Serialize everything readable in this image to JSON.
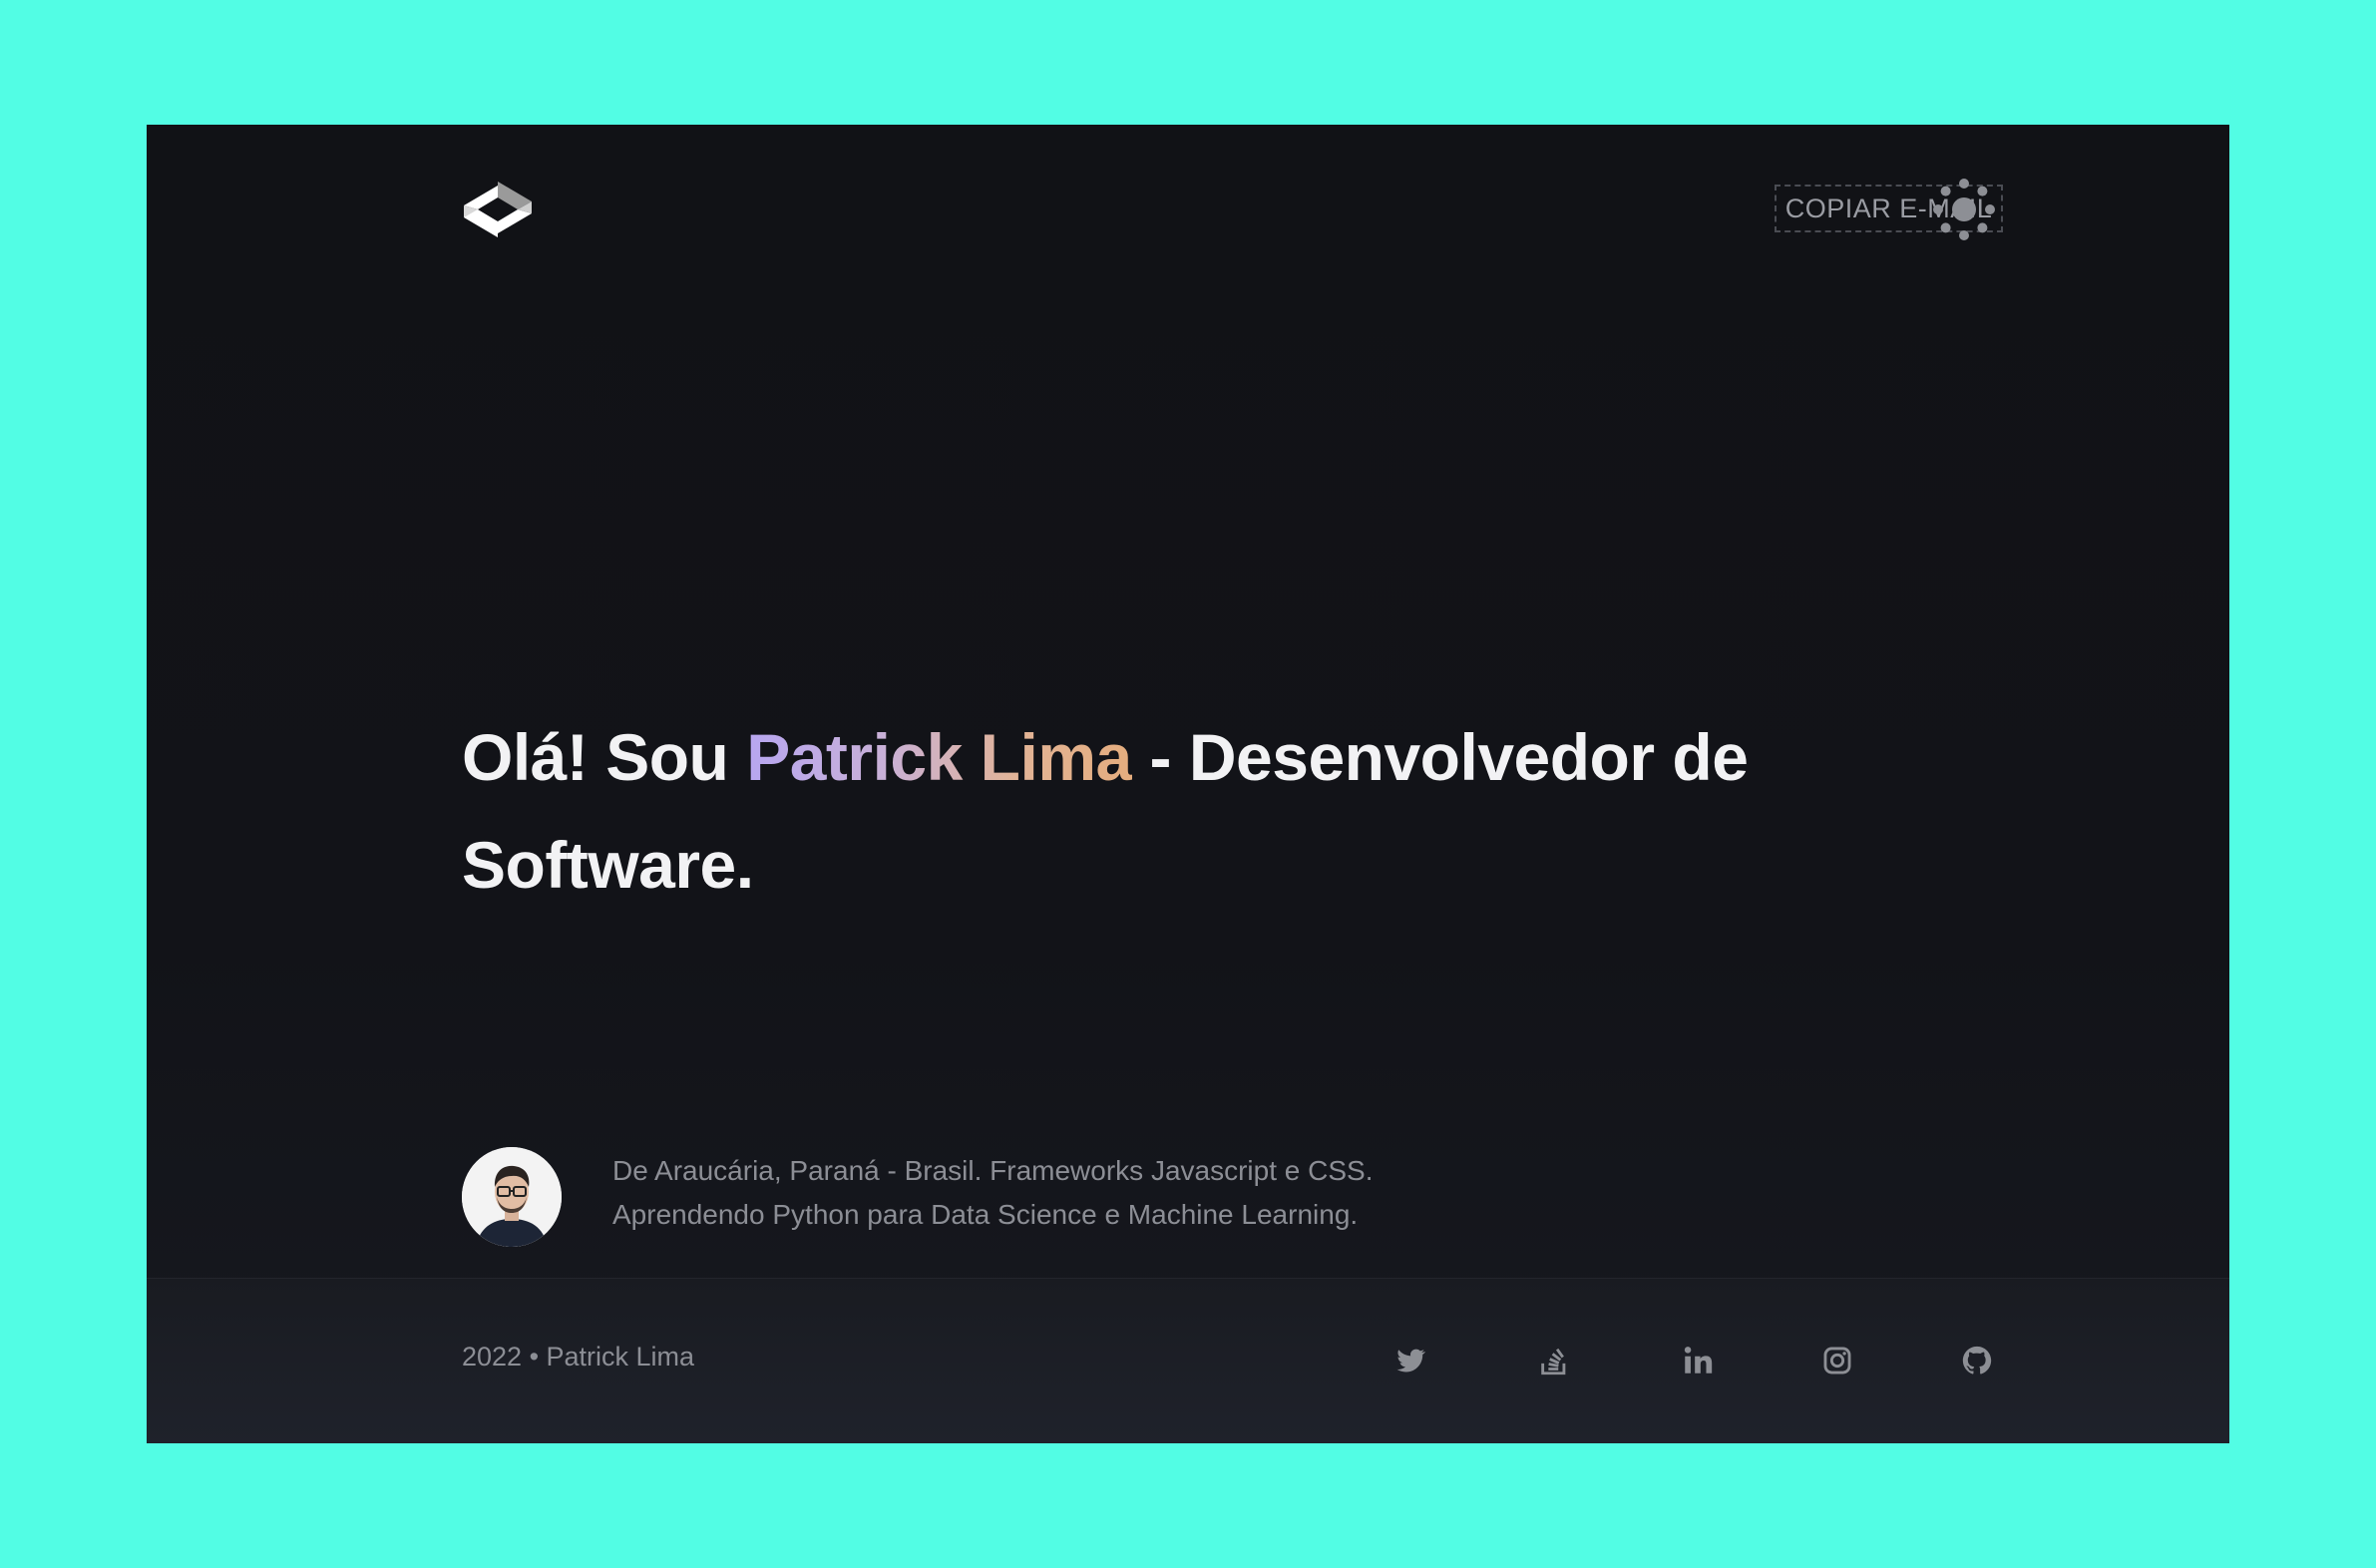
{
  "header": {
    "logo_icon": "code-brackets-logo-icon",
    "copy_email_label": "COPIAR E-MAIL",
    "theme_toggle_icon": "sun-icon"
  },
  "hero": {
    "greeting": "Olá! Sou ",
    "name": "Patrick Lima",
    "role": " - Desenvolvedor de Software.",
    "name_gradient_colors": [
      "#b7a6f0",
      "#e4ad7e"
    ]
  },
  "bio": {
    "line1": "De Araucária, Paraná - Brasil. Frameworks Javascript e CSS.",
    "line2": "Aprendendo Python para Data Science e Machine Learning."
  },
  "footer": {
    "copyright": "2022 • Patrick Lima",
    "social": [
      {
        "icon": "twitter-icon"
      },
      {
        "icon": "stackoverflow-icon"
      },
      {
        "icon": "linkedin-icon"
      },
      {
        "icon": "instagram-icon"
      },
      {
        "icon": "github-icon"
      }
    ]
  },
  "colors": {
    "page_background": "#52fde4",
    "window_background": "#111216",
    "footer_background": "#1f222b",
    "text_primary": "#f2f2f4",
    "text_muted": "#8c8e95"
  }
}
